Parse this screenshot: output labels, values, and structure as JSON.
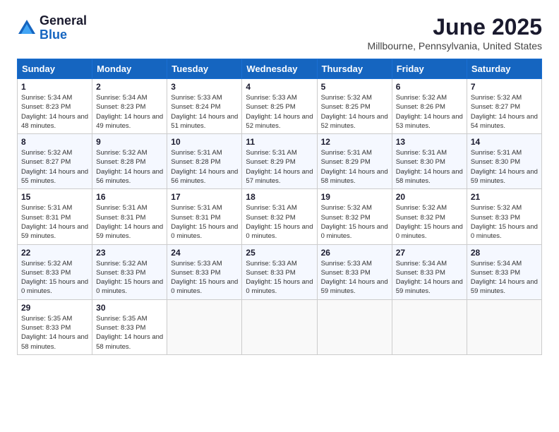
{
  "logo": {
    "general": "General",
    "blue": "Blue"
  },
  "title": "June 2025",
  "subtitle": "Millbourne, Pennsylvania, United States",
  "headers": [
    "Sunday",
    "Monday",
    "Tuesday",
    "Wednesday",
    "Thursday",
    "Friday",
    "Saturday"
  ],
  "weeks": [
    [
      {
        "day": "1",
        "sunrise": "5:34 AM",
        "sunset": "8:23 PM",
        "daylight": "14 hours and 48 minutes."
      },
      {
        "day": "2",
        "sunrise": "5:34 AM",
        "sunset": "8:23 PM",
        "daylight": "14 hours and 49 minutes."
      },
      {
        "day": "3",
        "sunrise": "5:33 AM",
        "sunset": "8:24 PM",
        "daylight": "14 hours and 51 minutes."
      },
      {
        "day": "4",
        "sunrise": "5:33 AM",
        "sunset": "8:25 PM",
        "daylight": "14 hours and 52 minutes."
      },
      {
        "day": "5",
        "sunrise": "5:32 AM",
        "sunset": "8:25 PM",
        "daylight": "14 hours and 52 minutes."
      },
      {
        "day": "6",
        "sunrise": "5:32 AM",
        "sunset": "8:26 PM",
        "daylight": "14 hours and 53 minutes."
      },
      {
        "day": "7",
        "sunrise": "5:32 AM",
        "sunset": "8:27 PM",
        "daylight": "14 hours and 54 minutes."
      }
    ],
    [
      {
        "day": "8",
        "sunrise": "5:32 AM",
        "sunset": "8:27 PM",
        "daylight": "14 hours and 55 minutes."
      },
      {
        "day": "9",
        "sunrise": "5:32 AM",
        "sunset": "8:28 PM",
        "daylight": "14 hours and 56 minutes."
      },
      {
        "day": "10",
        "sunrise": "5:31 AM",
        "sunset": "8:28 PM",
        "daylight": "14 hours and 56 minutes."
      },
      {
        "day": "11",
        "sunrise": "5:31 AM",
        "sunset": "8:29 PM",
        "daylight": "14 hours and 57 minutes."
      },
      {
        "day": "12",
        "sunrise": "5:31 AM",
        "sunset": "8:29 PM",
        "daylight": "14 hours and 58 minutes."
      },
      {
        "day": "13",
        "sunrise": "5:31 AM",
        "sunset": "8:30 PM",
        "daylight": "14 hours and 58 minutes."
      },
      {
        "day": "14",
        "sunrise": "5:31 AM",
        "sunset": "8:30 PM",
        "daylight": "14 hours and 59 minutes."
      }
    ],
    [
      {
        "day": "15",
        "sunrise": "5:31 AM",
        "sunset": "8:31 PM",
        "daylight": "14 hours and 59 minutes."
      },
      {
        "day": "16",
        "sunrise": "5:31 AM",
        "sunset": "8:31 PM",
        "daylight": "14 hours and 59 minutes."
      },
      {
        "day": "17",
        "sunrise": "5:31 AM",
        "sunset": "8:31 PM",
        "daylight": "15 hours and 0 minutes."
      },
      {
        "day": "18",
        "sunrise": "5:31 AM",
        "sunset": "8:32 PM",
        "daylight": "15 hours and 0 minutes."
      },
      {
        "day": "19",
        "sunrise": "5:32 AM",
        "sunset": "8:32 PM",
        "daylight": "15 hours and 0 minutes."
      },
      {
        "day": "20",
        "sunrise": "5:32 AM",
        "sunset": "8:32 PM",
        "daylight": "15 hours and 0 minutes."
      },
      {
        "day": "21",
        "sunrise": "5:32 AM",
        "sunset": "8:33 PM",
        "daylight": "15 hours and 0 minutes."
      }
    ],
    [
      {
        "day": "22",
        "sunrise": "5:32 AM",
        "sunset": "8:33 PM",
        "daylight": "15 hours and 0 minutes."
      },
      {
        "day": "23",
        "sunrise": "5:32 AM",
        "sunset": "8:33 PM",
        "daylight": "15 hours and 0 minutes."
      },
      {
        "day": "24",
        "sunrise": "5:33 AM",
        "sunset": "8:33 PM",
        "daylight": "15 hours and 0 minutes."
      },
      {
        "day": "25",
        "sunrise": "5:33 AM",
        "sunset": "8:33 PM",
        "daylight": "15 hours and 0 minutes."
      },
      {
        "day": "26",
        "sunrise": "5:33 AM",
        "sunset": "8:33 PM",
        "daylight": "14 hours and 59 minutes."
      },
      {
        "day": "27",
        "sunrise": "5:34 AM",
        "sunset": "8:33 PM",
        "daylight": "14 hours and 59 minutes."
      },
      {
        "day": "28",
        "sunrise": "5:34 AM",
        "sunset": "8:33 PM",
        "daylight": "14 hours and 59 minutes."
      }
    ],
    [
      {
        "day": "29",
        "sunrise": "5:35 AM",
        "sunset": "8:33 PM",
        "daylight": "14 hours and 58 minutes."
      },
      {
        "day": "30",
        "sunrise": "5:35 AM",
        "sunset": "8:33 PM",
        "daylight": "14 hours and 58 minutes."
      },
      null,
      null,
      null,
      null,
      null
    ]
  ]
}
